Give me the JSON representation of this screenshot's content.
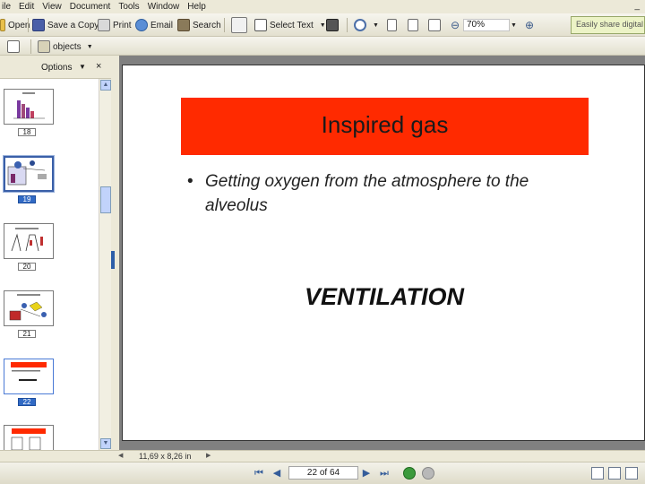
{
  "menu": [
    "ile",
    "Edit",
    "View",
    "Document",
    "Tools",
    "Window",
    "Help"
  ],
  "window_min": "_",
  "toolbar": {
    "open": "Open",
    "save_copy": "Save a Copy",
    "print": "Print",
    "email": "Email",
    "search": "Search",
    "select_text": "Select Text",
    "zoom_value": "70%",
    "help_text": "Easily share digital photos"
  },
  "toolbar2": {
    "objects": "objects"
  },
  "left_panel": {
    "options": "Options",
    "thumbs": [
      "18",
      "19",
      "20",
      "21",
      "22"
    ]
  },
  "slide": {
    "title": "Inspired gas",
    "bullet_marker": "•",
    "bullet": "Getting oxygen from the atmosphere to the alveolus",
    "heading": "VENTILATION"
  },
  "status": {
    "page_size": "11,69 x 8,26 in"
  },
  "nav": {
    "page_indicator": "22 of 64"
  },
  "colors": {
    "title_bg": "#ff2a00",
    "selected_thumb": "#316ac5"
  }
}
